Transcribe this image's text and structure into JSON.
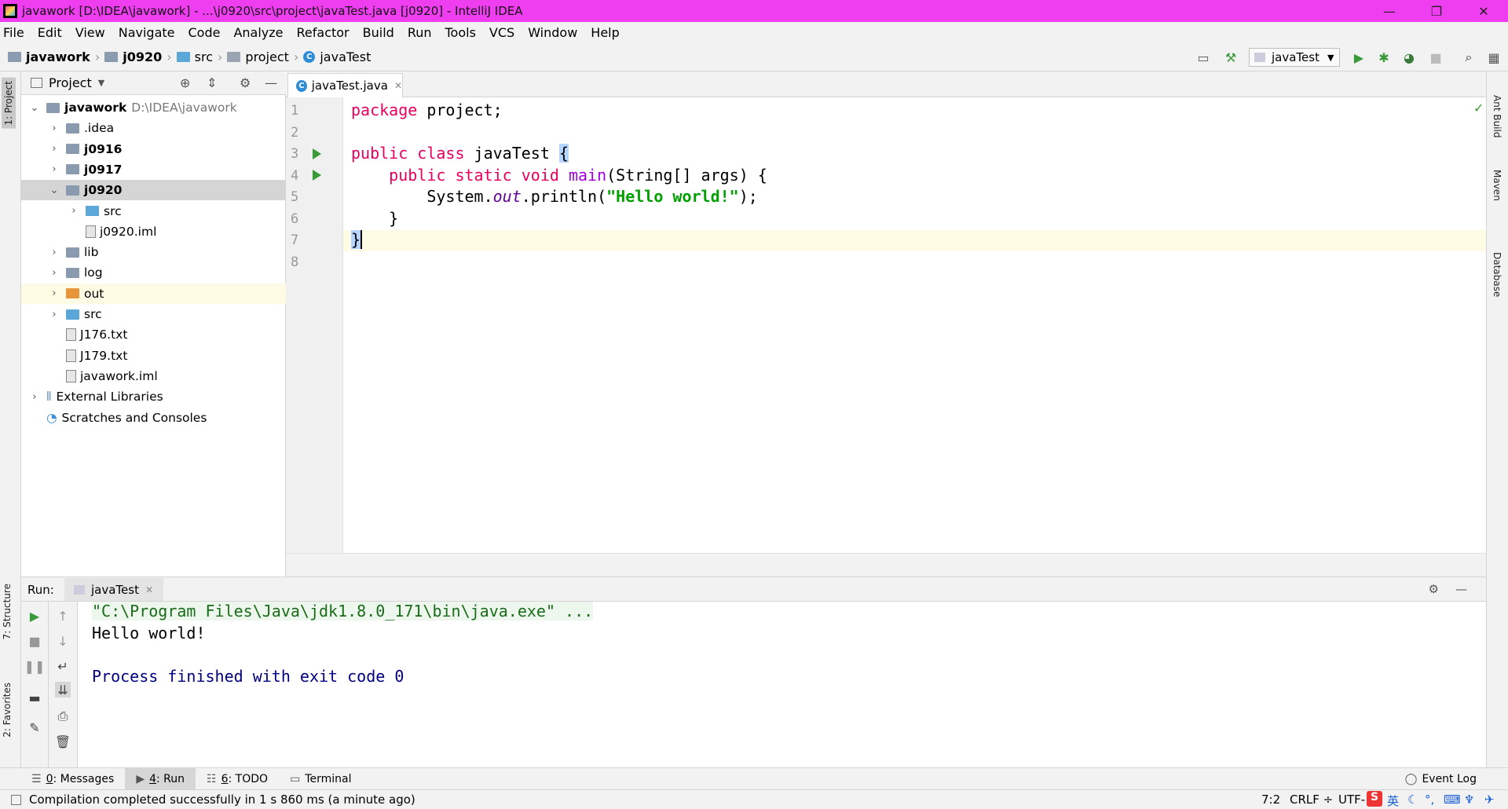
{
  "window": {
    "title": "javawork [D:\\IDEA\\javawork] - ...\\j0920\\src\\project\\javaTest.java [j0920] - IntelliJ IDEA",
    "minimize": "—",
    "restore": "❐",
    "close": "✕"
  },
  "menu": [
    "File",
    "Edit",
    "View",
    "Navigate",
    "Code",
    "Analyze",
    "Refactor",
    "Build",
    "Run",
    "Tools",
    "VCS",
    "Window",
    "Help"
  ],
  "breadcrumbs": [
    "javawork",
    "j0920",
    "src",
    "project",
    "javaTest"
  ],
  "toolbar": {
    "run_config": "javaTest"
  },
  "left_stripe": {
    "project": "1: Project",
    "structure": "7: Structure",
    "favorites": "2: Favorites"
  },
  "right_stripe": {
    "ant": "Ant Build",
    "maven": "Maven",
    "database": "Database"
  },
  "project_panel": {
    "title": "Project",
    "tree": [
      {
        "label": "javawork",
        "path": "D:\\IDEA\\javawork",
        "bold": true,
        "arrow": "⌄",
        "icon": "folder-module",
        "level": 0
      },
      {
        "label": ".idea",
        "arrow": "›",
        "icon": "folder",
        "level": 1
      },
      {
        "label": "j0916",
        "arrow": "›",
        "icon": "folder-module",
        "level": 1,
        "bold": true
      },
      {
        "label": "j0917",
        "arrow": "›",
        "icon": "folder-module",
        "level": 1,
        "bold": true
      },
      {
        "label": "j0920",
        "arrow": "⌄",
        "icon": "folder-module",
        "level": 1,
        "bold": true,
        "selected": true
      },
      {
        "label": "src",
        "arrow": "›",
        "icon": "folder-src",
        "level": 2
      },
      {
        "label": "j0920.iml",
        "arrow": "",
        "icon": "file",
        "level": 2
      },
      {
        "label": "lib",
        "arrow": "›",
        "icon": "folder",
        "level": 1
      },
      {
        "label": "log",
        "arrow": "›",
        "icon": "folder",
        "level": 1
      },
      {
        "label": "out",
        "arrow": "›",
        "icon": "folder-excluded",
        "level": 1,
        "highlight": true
      },
      {
        "label": "src",
        "arrow": "›",
        "icon": "folder-src",
        "level": 1
      },
      {
        "label": "J176.txt",
        "arrow": "",
        "icon": "file",
        "level": 1
      },
      {
        "label": "J179.txt",
        "arrow": "",
        "icon": "file",
        "level": 1
      },
      {
        "label": "javawork.iml",
        "arrow": "",
        "icon": "file",
        "level": 1
      },
      {
        "label": "External Libraries",
        "arrow": "›",
        "icon": "libraries",
        "level": 0
      },
      {
        "label": "Scratches and Consoles",
        "arrow": "",
        "icon": "scratches",
        "level": 0
      }
    ]
  },
  "editor": {
    "tab": "javaTest.java",
    "lines": [
      "1",
      "2",
      "3",
      "4",
      "5",
      "6",
      "7",
      "8"
    ],
    "code": {
      "l1_kw": "package",
      "l1_rest": " project;",
      "l3_kw": "public class",
      "l3_rest": " javaTest ",
      "l3_brace": "{",
      "l4_indent": "    ",
      "l4_kw": "public static void",
      "l4_sp": " ",
      "l4_fn": "main",
      "l4_rest": "(String[] args) {",
      "l5_a": "        System.",
      "l5_out": "out",
      "l5_b": ".println(",
      "l5_str": "\"Hello world!\"",
      "l5_c": ");",
      "l6": "    }",
      "l7_brace": "}"
    }
  },
  "run_panel": {
    "label": "Run:",
    "tab": "javaTest",
    "console": [
      "\"C:\\Program Files\\Java\\jdk1.8.0_171\\bin\\java.exe\" ...",
      "Hello world!",
      "",
      "Process finished with exit code 0"
    ]
  },
  "bottom_tabs": [
    {
      "key": "0",
      "label": ": Messages"
    },
    {
      "key": "4",
      "label": ": Run",
      "active": true
    },
    {
      "key": "6",
      "label": ": TODO"
    },
    {
      "key": "",
      "label": "Terminal"
    }
  ],
  "event_log": "Event Log",
  "status": {
    "message": "Compilation completed successfully in 1 s 860 ms (a minute ago)",
    "position": "7:2",
    "line_sep": "CRLF ÷",
    "encoding": "UTF-",
    "ime": "英"
  },
  "colors": {
    "titlebar": "#ef3df0",
    "keyword": "#e8005e",
    "string": "#00a000",
    "method": "#a100e0"
  }
}
